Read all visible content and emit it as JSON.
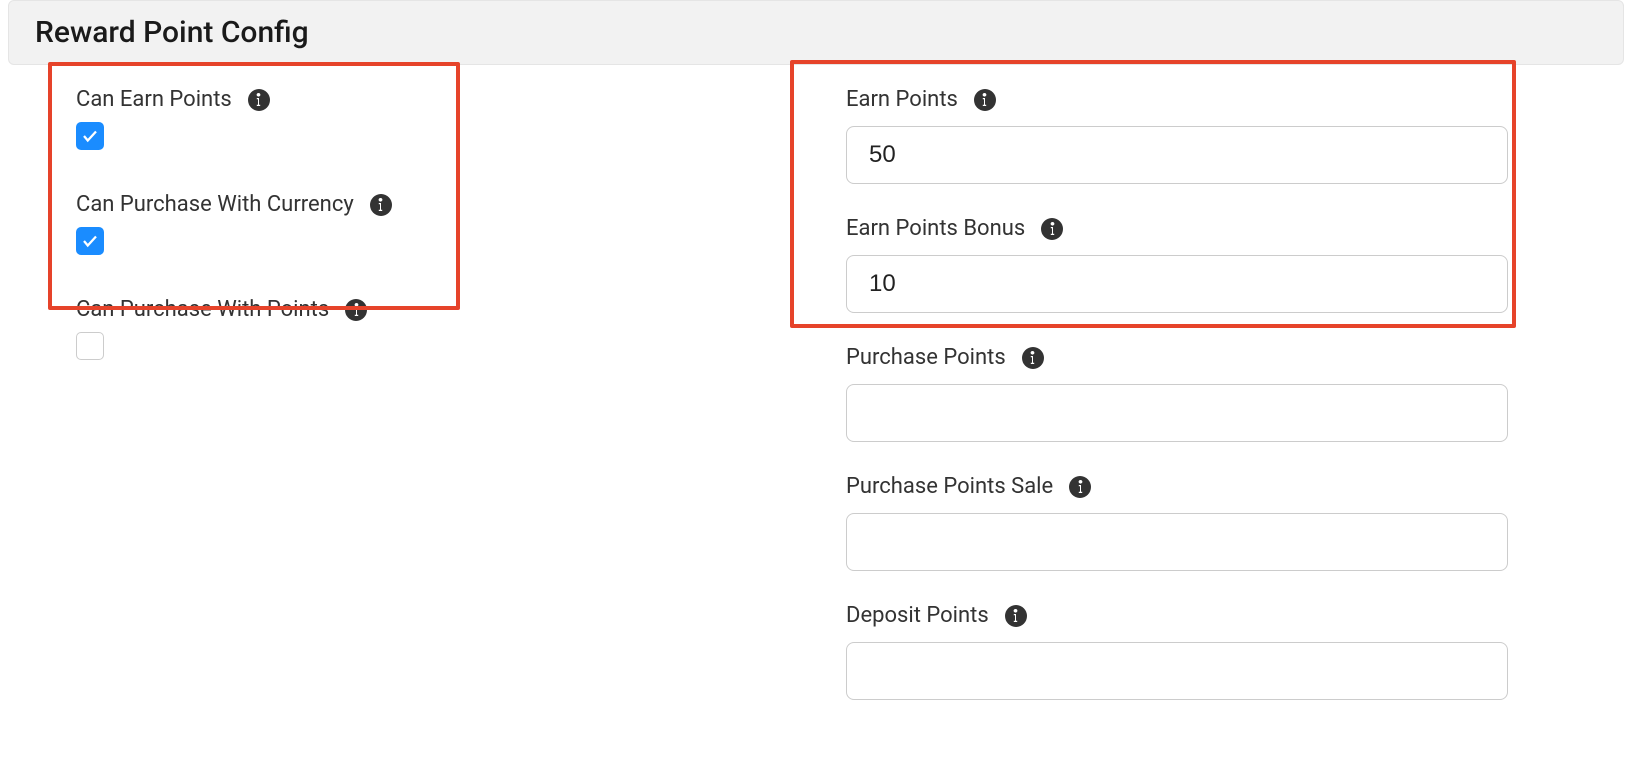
{
  "header": {
    "title": "Reward Point Config"
  },
  "left": {
    "can_earn_points": {
      "label": "Can Earn Points",
      "checked": true
    },
    "can_purchase_with_currency": {
      "label": "Can Purchase With Currency",
      "checked": true
    },
    "can_purchase_with_points": {
      "label": "Can Purchase With Points",
      "checked": false
    }
  },
  "right": {
    "earn_points": {
      "label": "Earn Points",
      "value": "50"
    },
    "earn_points_bonus": {
      "label": "Earn Points Bonus",
      "value": "10"
    },
    "purchase_points": {
      "label": "Purchase Points",
      "value": ""
    },
    "purchase_points_sale": {
      "label": "Purchase Points Sale",
      "value": ""
    },
    "deposit_points": {
      "label": "Deposit Points",
      "value": ""
    }
  }
}
